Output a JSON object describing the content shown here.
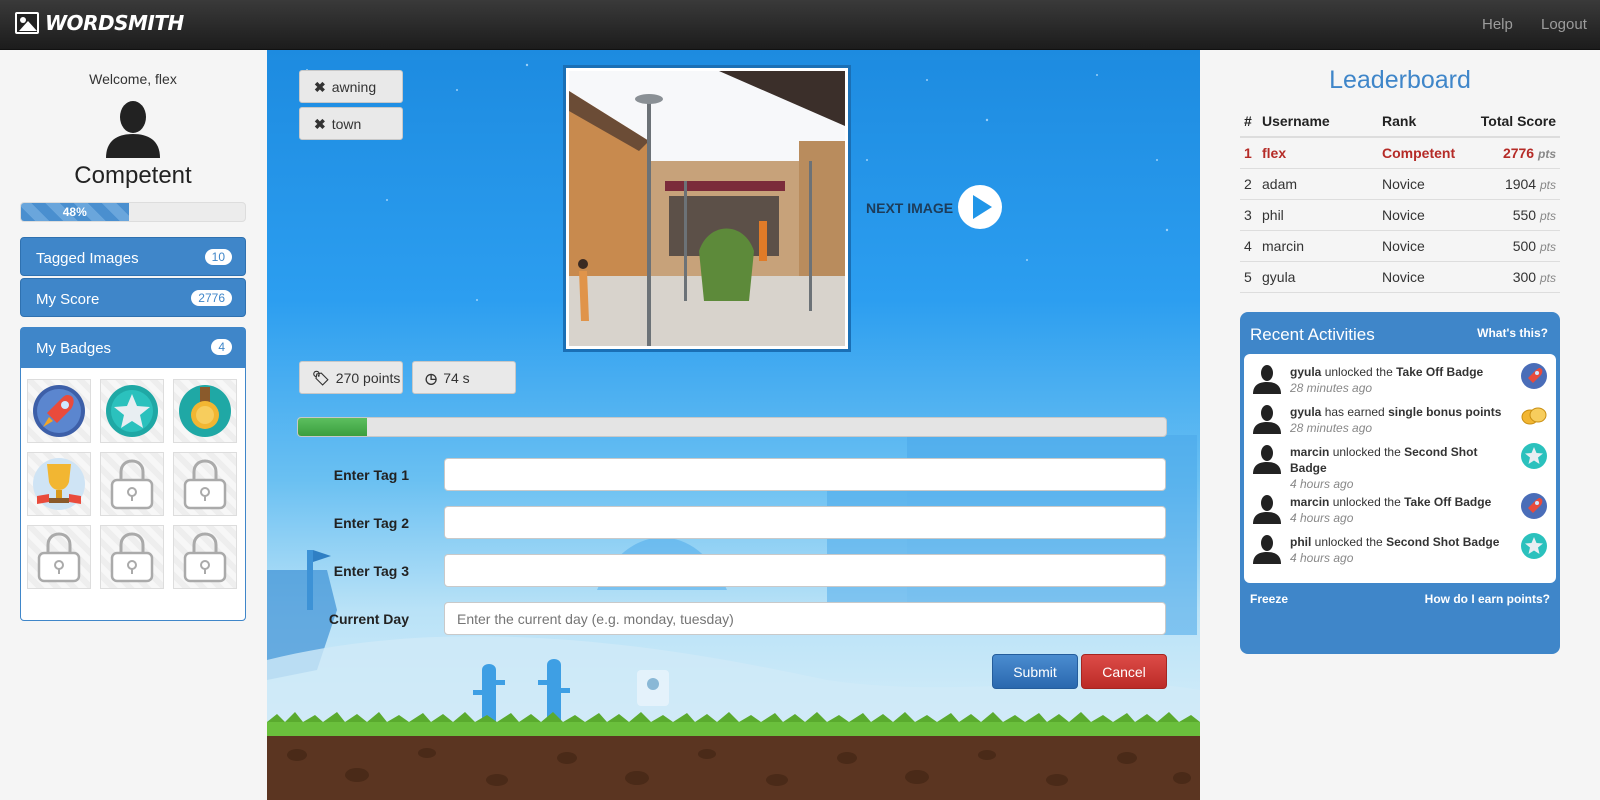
{
  "nav": {
    "brand": "WORDSMITH",
    "help": "Help",
    "logout": "Logout"
  },
  "profile": {
    "welcome": "Welcome, flex",
    "rank": "Competent",
    "progress_label": "48%",
    "progress_value": 48
  },
  "sidebar": {
    "tagged_images": {
      "label": "Tagged Images",
      "count": "10"
    },
    "my_score": {
      "label": "My Score",
      "count": "2776"
    },
    "my_badges": {
      "label": "My Badges",
      "count": "4"
    },
    "badges": [
      "rocket-badge",
      "star-badge",
      "medal-badge",
      "trophy-badge",
      "locked",
      "locked",
      "locked",
      "locked",
      "locked"
    ]
  },
  "game": {
    "tags": [
      "awning",
      "town"
    ],
    "next_image": "NEXT IMAGE",
    "points": "270 points",
    "time": "74 s",
    "progress_value": 8,
    "form": {
      "tag1_label": "Enter Tag 1",
      "tag2_label": "Enter Tag 2",
      "tag3_label": "Enter Tag 3",
      "day_label": "Current Day",
      "day_placeholder": "Enter the current day (e.g. monday, tuesday)",
      "submit": "Submit",
      "cancel": "Cancel"
    }
  },
  "leaderboard": {
    "title": "Leaderboard",
    "headers": [
      "#",
      "Username",
      "Rank",
      "Total Score"
    ],
    "pts_suffix": "pts",
    "rows": [
      {
        "pos": "1",
        "user": "flex",
        "rank": "Competent",
        "score": "2776"
      },
      {
        "pos": "2",
        "user": "adam",
        "rank": "Novice",
        "score": "1904"
      },
      {
        "pos": "3",
        "user": "phil",
        "rank": "Novice",
        "score": "550"
      },
      {
        "pos": "4",
        "user": "marcin",
        "rank": "Novice",
        "score": "500"
      },
      {
        "pos": "5",
        "user": "gyula",
        "rank": "Novice",
        "score": "300"
      }
    ]
  },
  "activities": {
    "title": "Recent Activities",
    "whats_this": "What's this?",
    "freeze": "Freeze",
    "how_earn": "How do I earn points?",
    "items": [
      {
        "user": "gyula",
        "verb": "unlocked the",
        "object": "Take Off Badge",
        "when": "28 minutes ago",
        "icon": "rocket-icon"
      },
      {
        "user": "gyula",
        "verb": "has earned",
        "object": "single bonus points",
        "when": "28 minutes ago",
        "icon": "coins-icon"
      },
      {
        "user": "marcin",
        "verb": "unlocked the",
        "object": "Second Shot Badge",
        "when": "4 hours ago",
        "icon": "star-icon"
      },
      {
        "user": "marcin",
        "verb": "unlocked the",
        "object": "Take Off Badge",
        "when": "4 hours ago",
        "icon": "rocket-icon"
      },
      {
        "user": "phil",
        "verb": "unlocked the",
        "object": "Second Shot Badge",
        "when": "4 hours ago",
        "icon": "star-icon"
      }
    ]
  },
  "colors": {
    "accent": "#3f86c9",
    "danger": "#b52b27",
    "success": "#4cae4f"
  }
}
